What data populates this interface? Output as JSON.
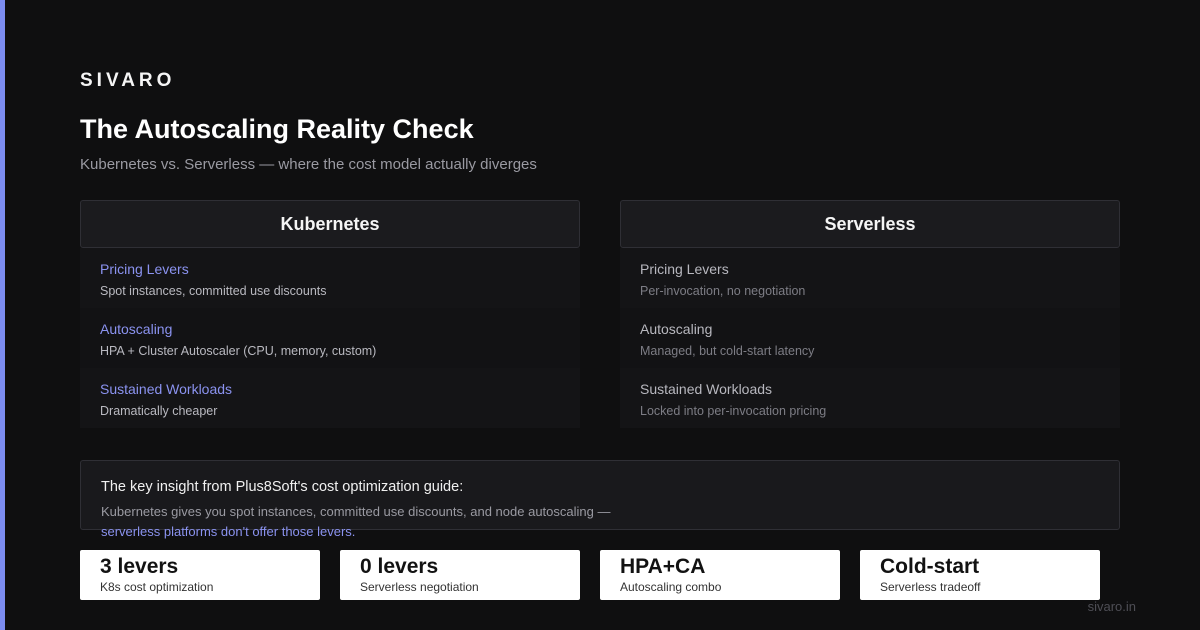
{
  "brand": "SIVARO",
  "title": "The Autoscaling Reality Check",
  "subtitle": "Kubernetes vs. Serverless — where the cost model actually diverges",
  "comparison": {
    "kubernetes": {
      "header": "Kubernetes",
      "rows": [
        {
          "label": "Pricing Levers",
          "value": "Spot instances, committed use discounts"
        },
        {
          "label": "Autoscaling",
          "value": "HPA + Cluster Autoscaler (CPU, memory, custom)"
        },
        {
          "label": "Sustained Workloads",
          "value": "Dramatically cheaper"
        }
      ]
    },
    "serverless": {
      "header": "Serverless",
      "rows": [
        {
          "label": "Pricing Levers",
          "value": "Per-invocation, no negotiation"
        },
        {
          "label": "Autoscaling",
          "value": "Managed, but cold-start latency"
        },
        {
          "label": "Sustained Workloads",
          "value": "Locked into per-invocation pricing"
        }
      ]
    }
  },
  "insight": {
    "heading": "The key insight from Plus8Soft's cost optimization guide:",
    "body": "Kubernetes gives you spot instances, committed use discounts, and node autoscaling —",
    "highlight": "serverless platforms don't offer those levers."
  },
  "stats": [
    {
      "value": "3 levers",
      "label": "K8s cost optimization"
    },
    {
      "value": "0 levers",
      "label": "Serverless negotiation"
    },
    {
      "value": "HPA+CA",
      "label": "Autoscaling combo"
    },
    {
      "value": "Cold-start",
      "label": "Serverless tradeoff"
    }
  ],
  "footer": "sivaro.in",
  "colors": {
    "accent": "#7c8cf0",
    "background": "#0f0f10"
  }
}
